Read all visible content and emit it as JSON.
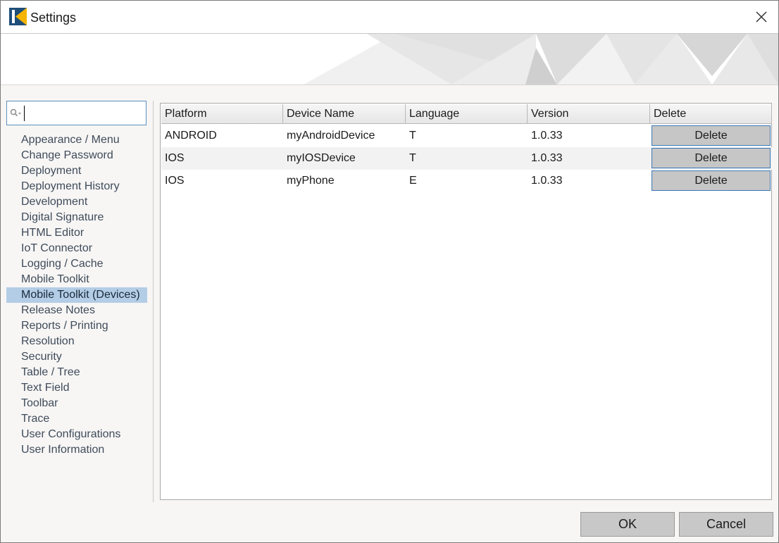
{
  "window": {
    "title": "Settings",
    "app_icon": "app-logo-icon",
    "close_icon": "close-icon"
  },
  "search": {
    "value": "",
    "placeholder": "",
    "icon": "search-icon"
  },
  "sidebar": {
    "items": [
      {
        "label": "Appearance / Menu"
      },
      {
        "label": "Change Password"
      },
      {
        "label": "Deployment"
      },
      {
        "label": "Deployment History"
      },
      {
        "label": "Development"
      },
      {
        "label": "Digital Signature"
      },
      {
        "label": "HTML Editor"
      },
      {
        "label": "IoT Connector"
      },
      {
        "label": "Logging / Cache"
      },
      {
        "label": "Mobile Toolkit"
      },
      {
        "label": "Mobile Toolkit (Devices)"
      },
      {
        "label": "Release Notes"
      },
      {
        "label": "Reports / Printing"
      },
      {
        "label": "Resolution"
      },
      {
        "label": "Security"
      },
      {
        "label": "Table / Tree"
      },
      {
        "label": "Text Field"
      },
      {
        "label": "Toolbar"
      },
      {
        "label": "Trace"
      },
      {
        "label": "User Configurations"
      },
      {
        "label": "User Information"
      }
    ],
    "selected": "Mobile Toolkit (Devices)"
  },
  "devices_table": {
    "columns": [
      "Platform",
      "Device Name",
      "Language",
      "Version",
      "Delete"
    ],
    "rows": [
      {
        "platform": "ANDROID",
        "device_name": "myAndroidDevice",
        "language": "T",
        "version": "1.0.33",
        "delete_label": "Delete"
      },
      {
        "platform": "IOS",
        "device_name": "myIOSDevice",
        "language": "T",
        "version": "1.0.33",
        "delete_label": "Delete"
      },
      {
        "platform": "IOS",
        "device_name": "myPhone",
        "language": "E",
        "version": "1.0.33",
        "delete_label": "Delete"
      }
    ]
  },
  "footer": {
    "ok_label": "OK",
    "cancel_label": "Cancel"
  },
  "colors": {
    "selection": "#b4cde6",
    "button": "#c6c6c6",
    "focus_border": "#3b78b5",
    "background": "#f7f6f5"
  }
}
